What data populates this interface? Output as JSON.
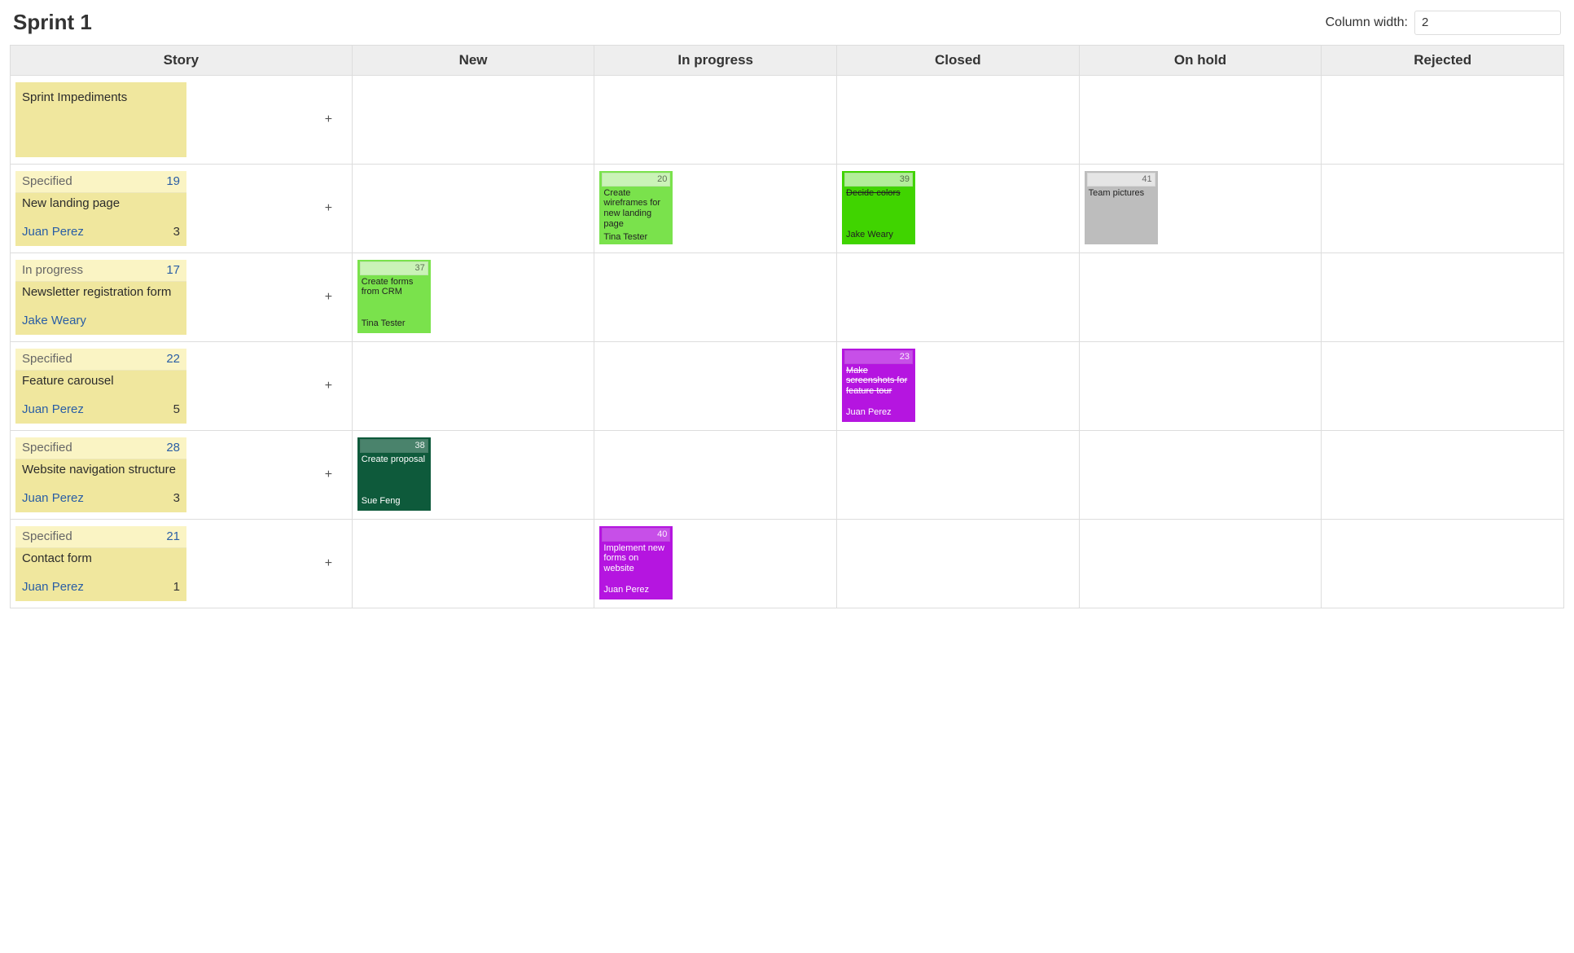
{
  "title": "Sprint 1",
  "column_width_label": "Column width:",
  "column_width_value": "2",
  "columns": {
    "story": "Story",
    "new": "New",
    "in_progress": "In progress",
    "closed": "Closed",
    "on_hold": "On hold",
    "rejected": "Rejected"
  },
  "add_symbol": "+",
  "rows": [
    {
      "story": {
        "impediments": true,
        "title": "Sprint Impediments"
      },
      "tasks": {}
    },
    {
      "story": {
        "status": "Specified",
        "id": "19",
        "title": "New landing page",
        "owner": "Juan Perez",
        "points": "3"
      },
      "tasks": {
        "in_progress": {
          "id": "20",
          "title": "Create wireframes for new landing page",
          "owner": "Tina Tester",
          "color": "green-light"
        },
        "closed": {
          "id": "39",
          "title": "Decide colors",
          "owner": "Jake Weary",
          "color": "green-bright",
          "strike": true
        },
        "on_hold": {
          "id": "41",
          "title": "Team pictures",
          "owner": "",
          "color": "grey"
        }
      }
    },
    {
      "story": {
        "status": "In progress",
        "id": "17",
        "title": "Newsletter registration form",
        "owner": "Jake Weary",
        "points": ""
      },
      "tasks": {
        "new": {
          "id": "37",
          "title": "Create forms from CRM",
          "owner": "Tina Tester",
          "color": "green-light"
        }
      }
    },
    {
      "story": {
        "status": "Specified",
        "id": "22",
        "title": "Feature carousel",
        "owner": "Juan Perez",
        "points": "5"
      },
      "tasks": {
        "closed": {
          "id": "23",
          "title": "Make screenshots for feature tour",
          "owner": "Juan Perez",
          "color": "purple",
          "white": true,
          "strike": true
        }
      }
    },
    {
      "story": {
        "status": "Specified",
        "id": "28",
        "title": "Website navigation structure",
        "owner": "Juan Perez",
        "points": "3"
      },
      "tasks": {
        "new": {
          "id": "38",
          "title": "Create proposal",
          "owner": "Sue Feng",
          "color": "green-dark",
          "white": true
        }
      }
    },
    {
      "story": {
        "status": "Specified",
        "id": "21",
        "title": "Contact form",
        "owner": "Juan Perez",
        "points": "1"
      },
      "tasks": {
        "in_progress": {
          "id": "40",
          "title": "Implement new forms on website",
          "owner": "Juan Perez",
          "color": "purple",
          "white": true
        }
      }
    }
  ]
}
